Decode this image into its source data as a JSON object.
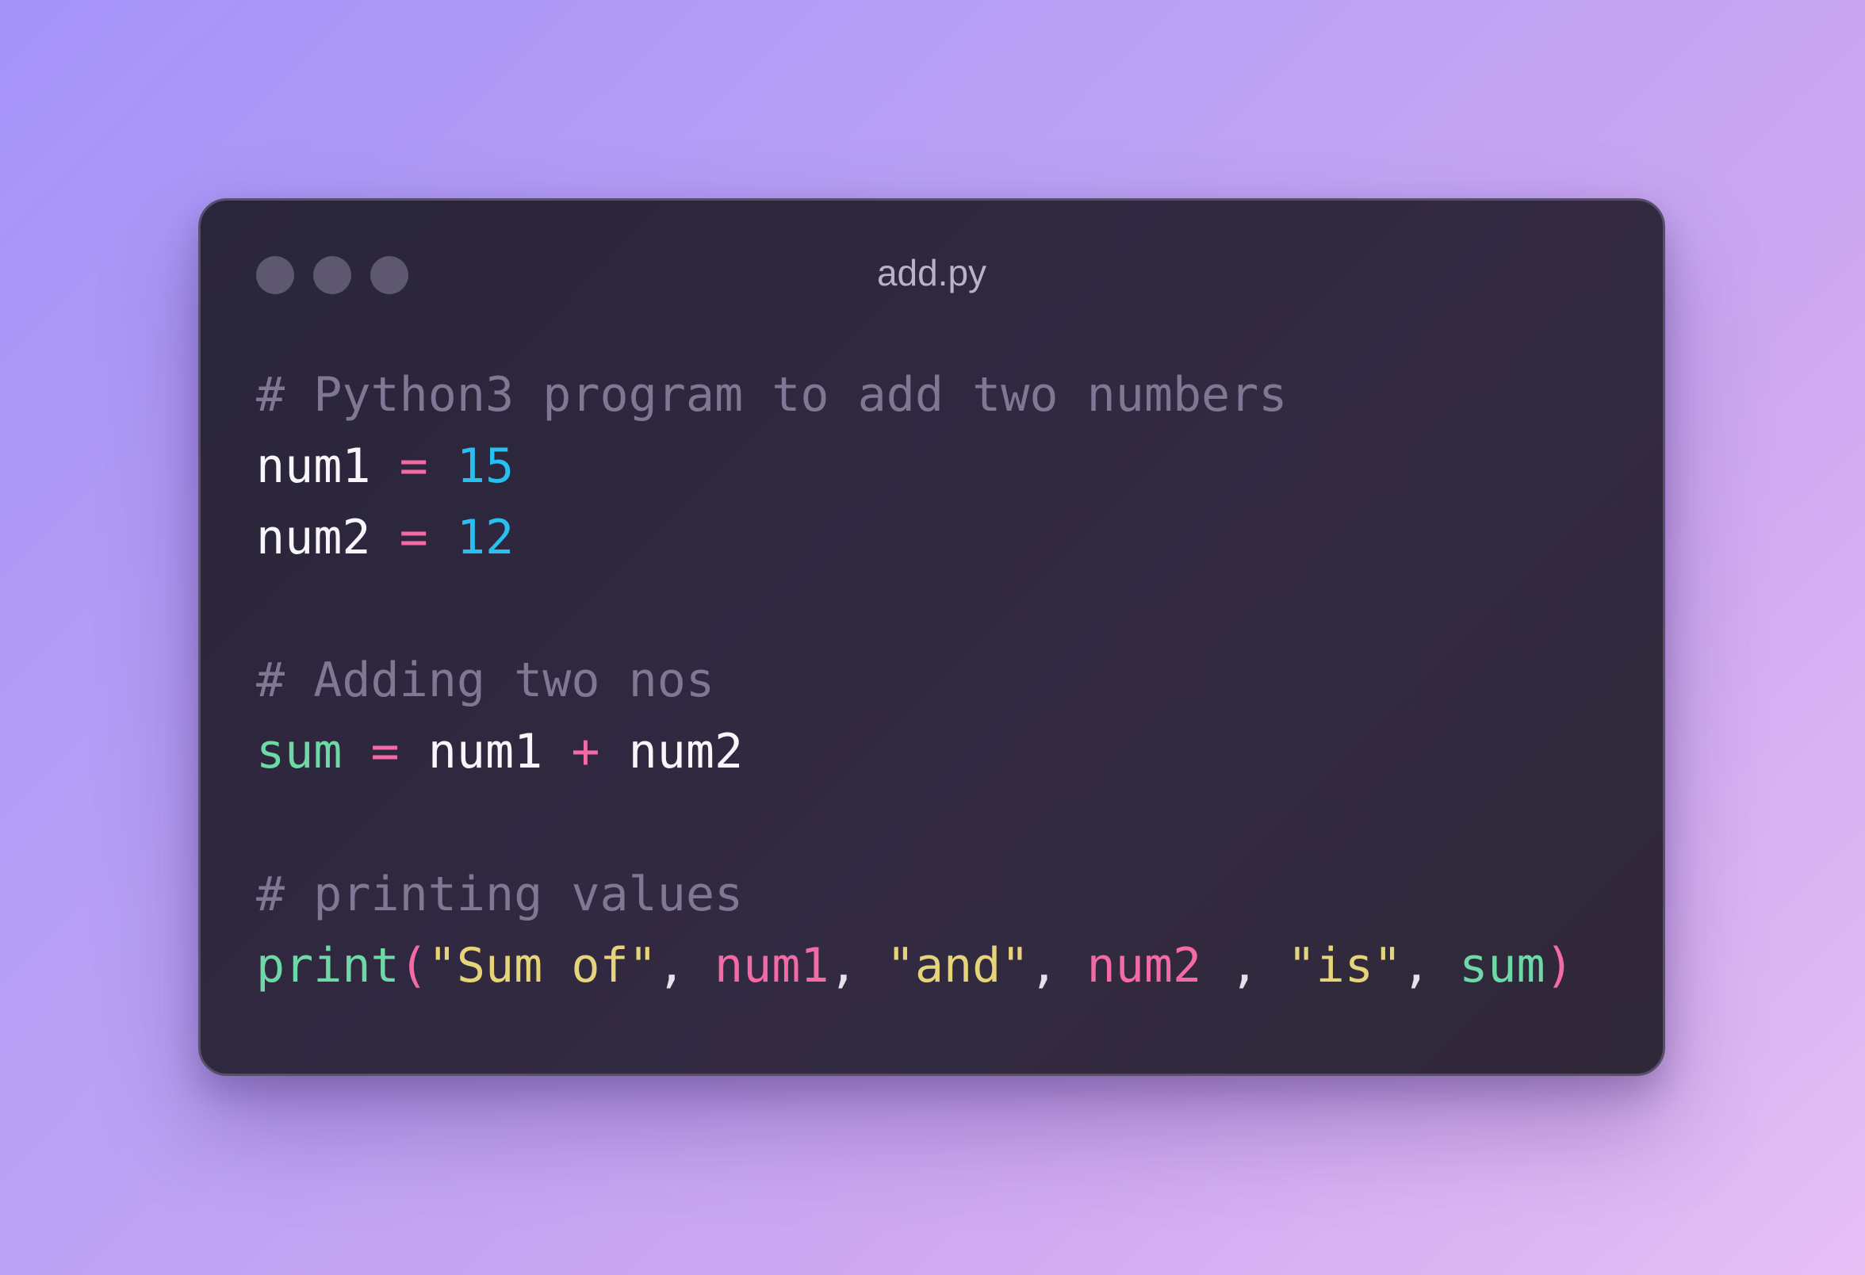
{
  "window": {
    "title": "add.py"
  },
  "code": {
    "language": "python",
    "lines": [
      [
        {
          "t": "# Python3 program to add two numbers",
          "k": "comment"
        }
      ],
      [
        {
          "t": "num1",
          "k": "ident"
        },
        {
          "t": " ",
          "k": "ident"
        },
        {
          "t": "=",
          "k": "op"
        },
        {
          "t": " ",
          "k": "ident"
        },
        {
          "t": "15",
          "k": "num"
        }
      ],
      [
        {
          "t": "num2",
          "k": "ident"
        },
        {
          "t": " ",
          "k": "ident"
        },
        {
          "t": "=",
          "k": "op"
        },
        {
          "t": " ",
          "k": "ident"
        },
        {
          "t": "12",
          "k": "num"
        }
      ],
      [],
      [
        {
          "t": "# Adding two nos",
          "k": "comment"
        }
      ],
      [
        {
          "t": "sum",
          "k": "func"
        },
        {
          "t": " ",
          "k": "ident"
        },
        {
          "t": "=",
          "k": "op"
        },
        {
          "t": " ",
          "k": "ident"
        },
        {
          "t": "num1",
          "k": "ident"
        },
        {
          "t": " ",
          "k": "ident"
        },
        {
          "t": "+",
          "k": "op"
        },
        {
          "t": " ",
          "k": "ident"
        },
        {
          "t": "num2",
          "k": "ident"
        }
      ],
      [],
      [
        {
          "t": "# printing values",
          "k": "comment"
        }
      ],
      [
        {
          "t": "print",
          "k": "func"
        },
        {
          "t": "(",
          "k": "op"
        },
        {
          "t": "\"Sum of\"",
          "k": "str"
        },
        {
          "t": ", ",
          "k": "punct"
        },
        {
          "t": "num1",
          "k": "arg"
        },
        {
          "t": ", ",
          "k": "punct"
        },
        {
          "t": "\"and\"",
          "k": "str"
        },
        {
          "t": ", ",
          "k": "punct"
        },
        {
          "t": "num2",
          "k": "arg"
        },
        {
          "t": " , ",
          "k": "punct"
        },
        {
          "t": "\"is\"",
          "k": "str"
        },
        {
          "t": ", ",
          "k": "punct"
        },
        {
          "t": "sum",
          "k": "func"
        },
        {
          "t": ")",
          "k": "op"
        }
      ]
    ]
  },
  "colors": {
    "comment": "#7f7894",
    "identifier": "#f8f6fb",
    "operator": "#f36aa4",
    "number": "#27c0f0",
    "function": "#6ed8a6",
    "string": "#e6d47a"
  }
}
